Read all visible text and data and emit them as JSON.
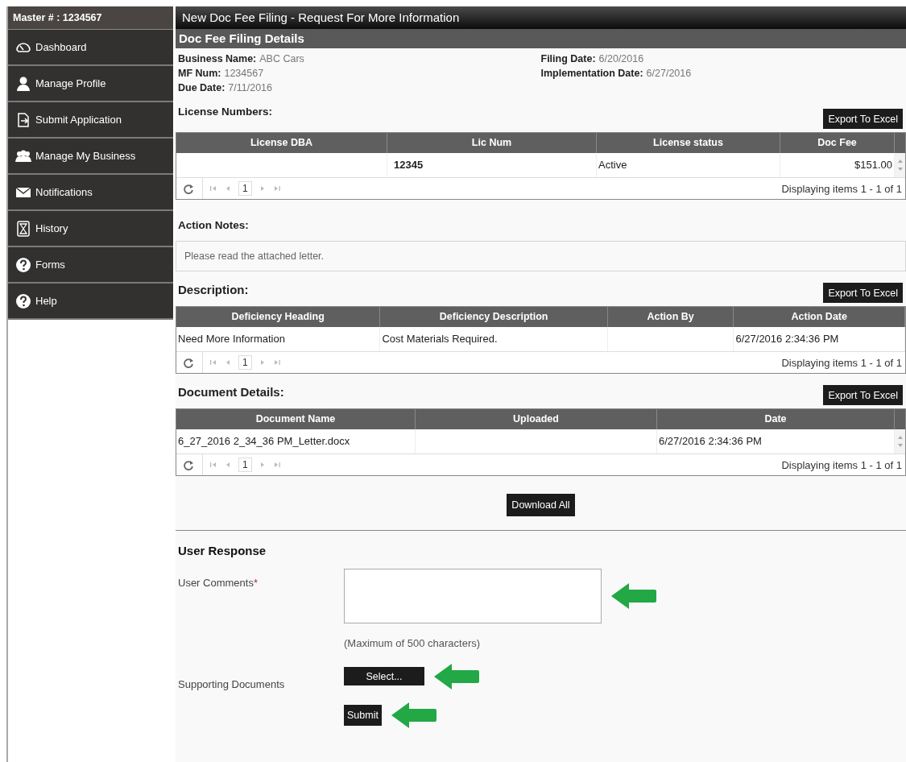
{
  "sidebar": {
    "header": "Master # : 1234567",
    "items": [
      {
        "label": "Dashboard"
      },
      {
        "label": "Manage Profile"
      },
      {
        "label": "Submit Application"
      },
      {
        "label": "Manage My Business"
      },
      {
        "label": "Notifications"
      },
      {
        "label": "History"
      },
      {
        "label": "Forms"
      },
      {
        "label": "Help"
      }
    ]
  },
  "window": {
    "title": "New Doc Fee Filing - Request For More Information"
  },
  "details": {
    "heading": "Doc Fee Filing Details",
    "left": [
      {
        "label": "Business Name:",
        "value": "ABC Cars"
      },
      {
        "label": "MF Num:",
        "value": "1234567"
      },
      {
        "label": "Due Date:",
        "value": "7/11/2016"
      }
    ],
    "right": [
      {
        "label": "Filing Date:",
        "value": "6/20/2016"
      },
      {
        "label": "Implementation Date:",
        "value": "6/27/2016"
      }
    ]
  },
  "license_table": {
    "title": "License Numbers:",
    "export_button": "Export To Excel",
    "columns": [
      {
        "label": "License DBA"
      },
      {
        "label": "Lic Num"
      },
      {
        "label": "License status"
      },
      {
        "label": "Doc Fee"
      }
    ],
    "rows": [
      [
        null,
        "12345",
        "Active",
        "$151.00"
      ]
    ],
    "pager": {
      "page": "1",
      "summary": "Displaying items 1 - 1 of 1"
    }
  },
  "action_notes": {
    "title": "Action Notes:",
    "text": "Please read the attached letter."
  },
  "description_table": {
    "title": "Description:",
    "export_button": "Export To Excel",
    "columns": [
      {
        "label": "Deficiency Heading"
      },
      {
        "label": "Deficiency Description"
      },
      {
        "label": "Action By"
      },
      {
        "label": "Action Date"
      }
    ],
    "rows": [
      [
        "Need More Information",
        "Cost Materials Required.",
        null,
        "6/27/2016 2:34:36 PM"
      ]
    ],
    "pager": {
      "page": "1",
      "summary": "Displaying items 1 - 1 of 1"
    }
  },
  "document_table": {
    "title": "Document Details:",
    "export_button": "Export To Excel",
    "columns": [
      {
        "label": "Document Name"
      },
      {
        "label": "Uploaded"
      },
      {
        "label": "Date"
      }
    ],
    "rows": [
      [
        "6_27_2016 2_34_36 PM_Letter.docx",
        null,
        "6/27/2016 2:34:36 PM"
      ]
    ],
    "pager": {
      "page": "1",
      "summary": "Displaying items 1 - 1 of 1"
    }
  },
  "download_button": "Download All",
  "user_response": {
    "title": "User Response",
    "comments": {
      "label": "User Comments",
      "required_mark": "*",
      "hint": "(Maximum of 500 characters)",
      "annotated": true
    },
    "documents": {
      "label": "Supporting Documents",
      "button": "Select...",
      "annotated": true
    },
    "submit": {
      "label": "Submit",
      "annotated": true
    }
  }
}
